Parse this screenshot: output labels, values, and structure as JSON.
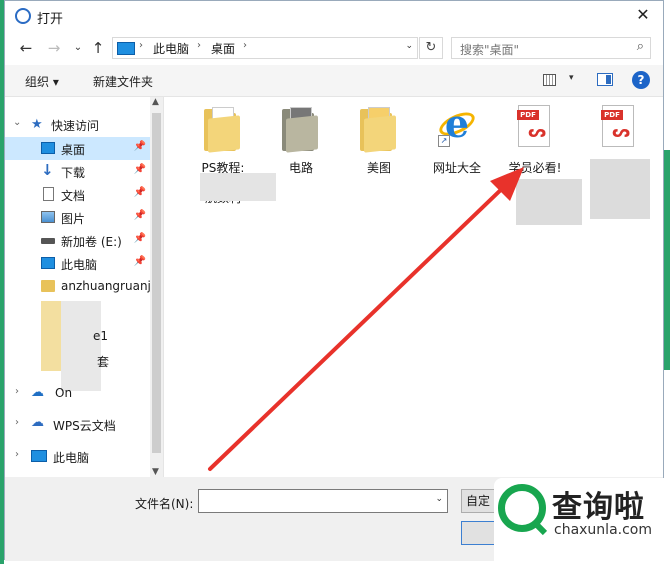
{
  "window": {
    "title": "打开",
    "close_glyph": "✕"
  },
  "nav": {
    "back": "←",
    "forward": "→",
    "up_chevron": "⌄",
    "up": "↑"
  },
  "address": {
    "segments": [
      "此电脑",
      "桌面"
    ],
    "chevron": "›",
    "refresh": "↻"
  },
  "search": {
    "placeholder": "搜索\"桌面\"",
    "icon": "⌕"
  },
  "toolbar": {
    "organize": "组织 ▾",
    "new_folder": "新建文件夹",
    "view_drop": "▾",
    "help": "?"
  },
  "sidebar": {
    "quick_access": "快速访问",
    "items": [
      {
        "label": "桌面",
        "icon": "desktop-icon",
        "pin": "📌"
      },
      {
        "label": "下载",
        "icon": "download-icon",
        "pin": "📌"
      },
      {
        "label": "文档",
        "icon": "document-icon",
        "pin": "📌"
      },
      {
        "label": "图片",
        "icon": "picture-icon",
        "pin": "📌"
      },
      {
        "label": "新加卷 (E:)",
        "icon": "drive-icon",
        "pin": "📌"
      },
      {
        "label": "此电脑",
        "icon": "pc-icon",
        "pin": "📌"
      },
      {
        "label": "anzhuangruanj",
        "icon": "folder-icon"
      }
    ],
    "fragments": [
      "e1",
      "套"
    ],
    "onedrive": "On",
    "wps": "WPS云文档",
    "this_pc": "此电脑",
    "expand_open": "⌄",
    "expand_closed": "›"
  },
  "files": [
    {
      "label": "PS教程:",
      "sub": "航数利",
      "type": "folder"
    },
    {
      "label": "电路",
      "type": "folder-dark"
    },
    {
      "label": "美图",
      "type": "folder-image"
    },
    {
      "label": "网址大全",
      "type": "ie-shortcut"
    },
    {
      "label": "学员必看!",
      "type": "pdf"
    },
    {
      "label": "",
      "type": "pdf"
    }
  ],
  "pdf_tag": "PDF",
  "bottom": {
    "filename_label": "文件名(N):",
    "filename_value": "",
    "type_label": "自定",
    "open_label": "打",
    "drop": "⌄"
  },
  "watermark": {
    "title": "查询啦",
    "url": "chaxunla.com"
  },
  "colors": {
    "arrow": "#e8322b",
    "selection": "#cce8ff",
    "accent": "#1c64c8",
    "brand_green": "#18a64f"
  }
}
